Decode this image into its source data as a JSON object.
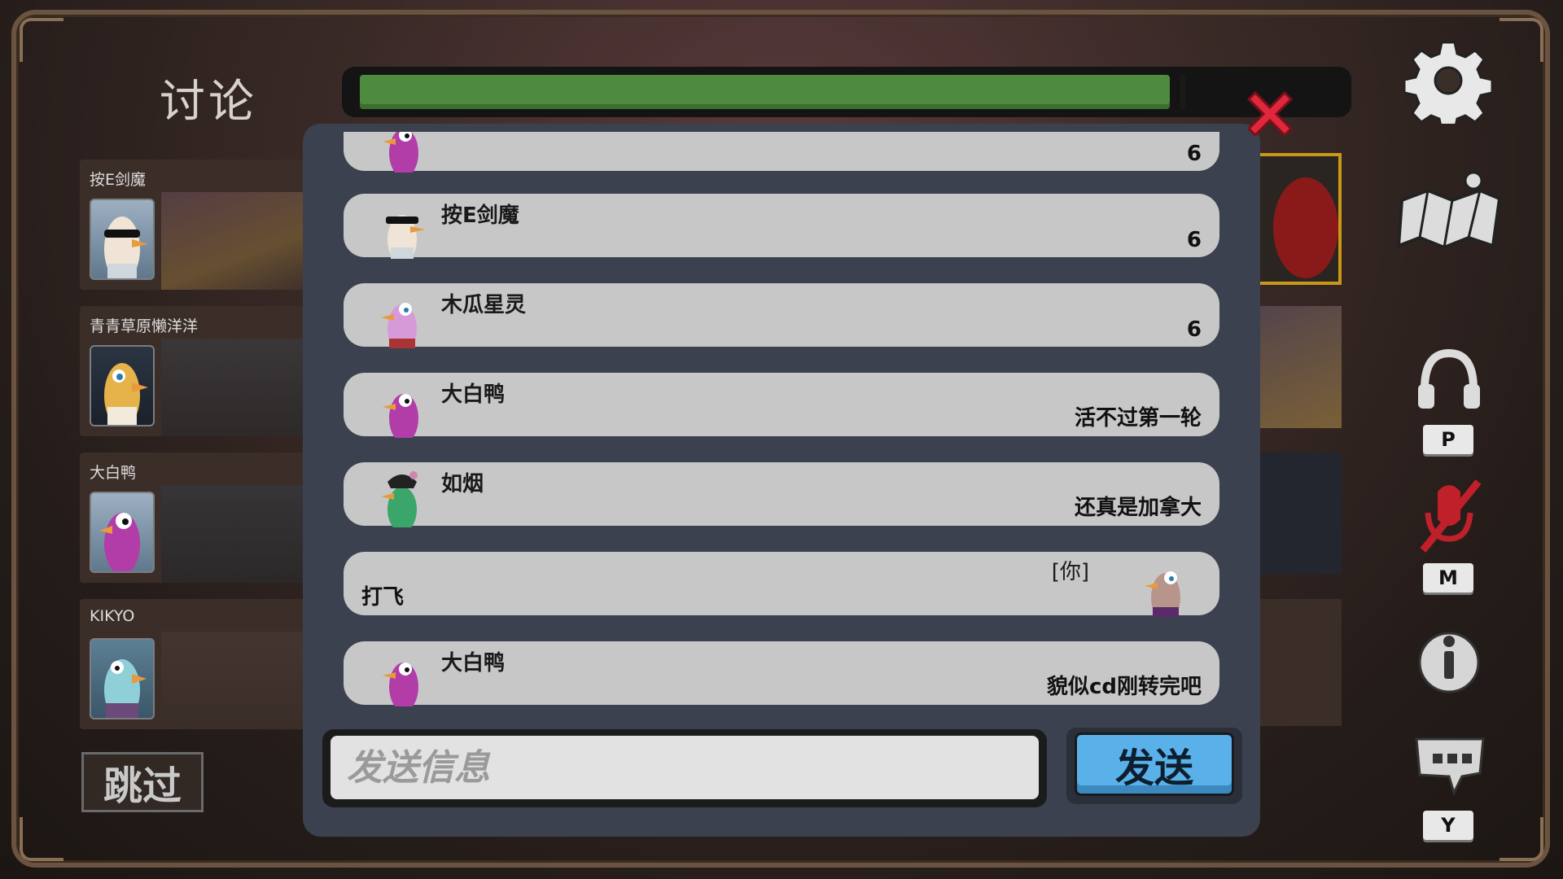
{
  "title": "讨论",
  "timer": {
    "progress": 0.93
  },
  "players": [
    {
      "name": "按E剑魔",
      "avatar": "sunglasses-goose"
    },
    {
      "name": "青青草原懒洋洋",
      "avatar": "yellow-goose"
    },
    {
      "name": "大白鸭",
      "avatar": "purple-duck"
    },
    {
      "name": "KIKYO",
      "avatar": "blue-goose"
    }
  ],
  "skip_label": "跳过",
  "chat": {
    "messages": [
      {
        "name": "",
        "text": "6",
        "avatar": "purple-duck",
        "self": false
      },
      {
        "name": "按E剑魔",
        "text": "6",
        "avatar": "sunglasses-goose",
        "self": false
      },
      {
        "name": "木瓜星灵",
        "text": "6",
        "avatar": "pink-goose",
        "self": false
      },
      {
        "name": "大白鸭",
        "text": "活不过第一轮",
        "avatar": "purple-duck",
        "self": false
      },
      {
        "name": "如烟",
        "text": "还真是加拿大",
        "avatar": "green-goose",
        "self": false
      },
      {
        "name": "",
        "you_tag": "[你]",
        "text": "打飞",
        "avatar": "brown-goose",
        "self": true
      },
      {
        "name": "大白鸭",
        "text": "貌似cd刚转完吧",
        "avatar": "purple-duck",
        "self": false
      }
    ],
    "input_placeholder": "发送信息",
    "send_label": "发送"
  },
  "side_keys": {
    "voice": "P",
    "mute": "M",
    "emote": "Y"
  },
  "icons": [
    "gear-icon",
    "map-icon",
    "headphones-icon",
    "muted-mic-icon",
    "info-icon",
    "emote-icon",
    "close-icon"
  ],
  "colors": {
    "timer": "#4f8b3f",
    "send": "#5ab0e8",
    "close": "#e0283c",
    "mute": "#c0202a",
    "gold": "#c99818"
  }
}
